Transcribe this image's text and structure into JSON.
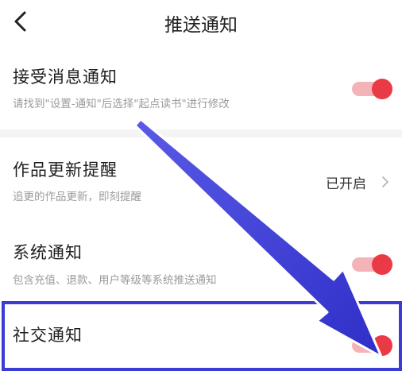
{
  "header": {
    "title": "推送通知",
    "back_icon": "chevron-left-icon"
  },
  "items": [
    {
      "title": "接受消息通知",
      "subtitle": "请找到\"设置-通知\"后选择\"起点读书\"进行修改",
      "control": "toggle",
      "enabled": true
    },
    {
      "title": "作品更新提醒",
      "subtitle": "追更的作品更新，即刻提醒",
      "control": "value",
      "value": "已开启",
      "icon": "chevron-right-icon"
    },
    {
      "title": "系统通知",
      "subtitle": "包含充值、退款、用户等级等系统推送通知",
      "control": "toggle",
      "enabled": true
    },
    {
      "title": "社交通知",
      "control": "toggle",
      "enabled": true
    }
  ],
  "colors": {
    "toggle_on": "#ea3a46",
    "toggle_track": "#f4b3b6",
    "annotation": "#3b3bd6"
  }
}
